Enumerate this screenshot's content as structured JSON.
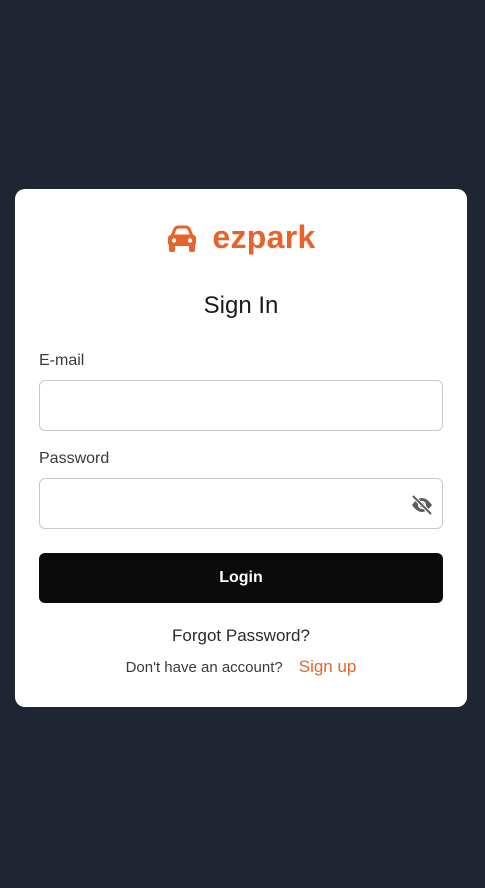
{
  "brand": {
    "name": "ezpark",
    "icon": "car-icon",
    "accent_color": "#e8622a"
  },
  "form": {
    "title": "Sign In",
    "email": {
      "label": "E-mail",
      "value": "",
      "placeholder": ""
    },
    "password": {
      "label": "Password",
      "value": "",
      "placeholder": "",
      "visibility_icon": "eye-off-icon"
    },
    "login_label": "Login",
    "forgot_label": "Forgot Password?",
    "signup_prompt": "Don't have an account?",
    "signup_label": "Sign up"
  },
  "colors": {
    "background": "#1f2533",
    "card": "#ffffff",
    "button": "#0b0b0b"
  }
}
